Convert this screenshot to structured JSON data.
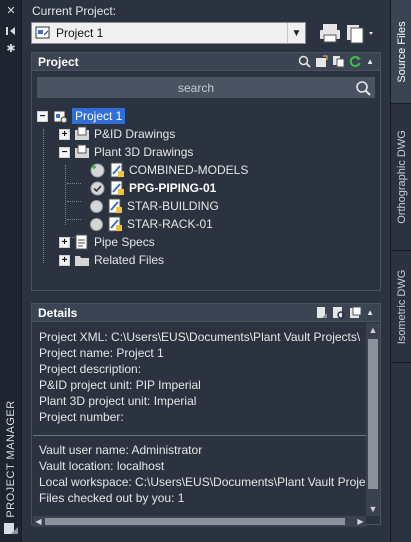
{
  "palette": {
    "title": "PROJECT MANAGER"
  },
  "side_tabs": [
    {
      "label": "Source Files",
      "active": true
    },
    {
      "label": "Orthographic DWG",
      "active": false
    },
    {
      "label": "Isometric DWG",
      "active": false
    }
  ],
  "current_project": {
    "label": "Current Project:",
    "value": "Project 1"
  },
  "project_panel": {
    "title": "Project",
    "search_placeholder": "search",
    "tree": {
      "root": "Project 1",
      "pid_drawings": "P&ID Drawings",
      "plant3d_drawings": "Plant 3D Drawings",
      "drawings": [
        {
          "label": "COMBINED-MODELS",
          "bold": false,
          "status": "add"
        },
        {
          "label": "PPG-PIPING-01",
          "bold": true,
          "status": "checked"
        },
        {
          "label": "STAR-BUILDING",
          "bold": false,
          "status": "none"
        },
        {
          "label": "STAR-RACK-01",
          "bold": false,
          "status": "none"
        }
      ],
      "pipe_specs": "Pipe Specs",
      "related_files": "Related Files"
    }
  },
  "details_panel": {
    "title": "Details",
    "lines_top": [
      "Project XML: C:\\Users\\EUS\\Documents\\Plant Vault Projects\\",
      "Project name: Project 1",
      "Project description:",
      "P&ID project unit: PIP Imperial",
      "Plant 3D project unit: Imperial",
      "Project number:"
    ],
    "lines_bottom": [
      "Vault user name: Administrator",
      "Vault location: localhost",
      "Local workspace: C:\\Users\\EUS\\Documents\\Plant Vault Projec",
      "Files checked out by you: 1"
    ]
  },
  "colors": {
    "background": "#2b3340",
    "header": "#3b4453",
    "selection": "#2f6fd6",
    "accent_green": "#3fbf4a"
  }
}
